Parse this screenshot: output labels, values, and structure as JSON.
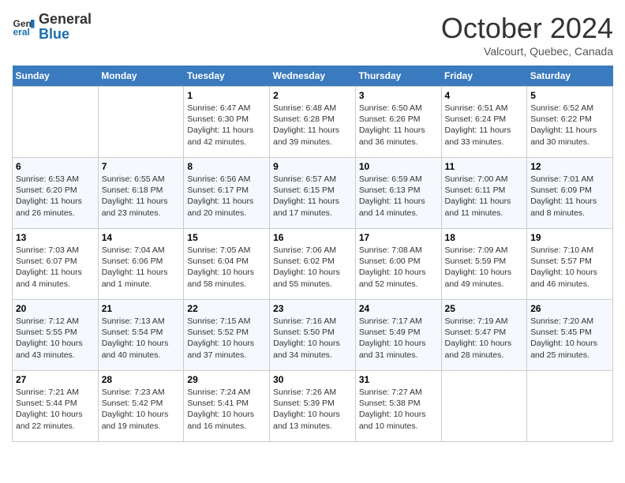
{
  "header": {
    "logo_general": "General",
    "logo_blue": "Blue",
    "month_title": "October 2024",
    "location": "Valcourt, Quebec, Canada"
  },
  "days_of_week": [
    "Sunday",
    "Monday",
    "Tuesday",
    "Wednesday",
    "Thursday",
    "Friday",
    "Saturday"
  ],
  "weeks": [
    [
      {
        "day": "",
        "sunrise": "",
        "sunset": "",
        "daylight": ""
      },
      {
        "day": "",
        "sunrise": "",
        "sunset": "",
        "daylight": ""
      },
      {
        "day": "1",
        "sunrise": "Sunrise: 6:47 AM",
        "sunset": "Sunset: 6:30 PM",
        "daylight": "Daylight: 11 hours and 42 minutes."
      },
      {
        "day": "2",
        "sunrise": "Sunrise: 6:48 AM",
        "sunset": "Sunset: 6:28 PM",
        "daylight": "Daylight: 11 hours and 39 minutes."
      },
      {
        "day": "3",
        "sunrise": "Sunrise: 6:50 AM",
        "sunset": "Sunset: 6:26 PM",
        "daylight": "Daylight: 11 hours and 36 minutes."
      },
      {
        "day": "4",
        "sunrise": "Sunrise: 6:51 AM",
        "sunset": "Sunset: 6:24 PM",
        "daylight": "Daylight: 11 hours and 33 minutes."
      },
      {
        "day": "5",
        "sunrise": "Sunrise: 6:52 AM",
        "sunset": "Sunset: 6:22 PM",
        "daylight": "Daylight: 11 hours and 30 minutes."
      }
    ],
    [
      {
        "day": "6",
        "sunrise": "Sunrise: 6:53 AM",
        "sunset": "Sunset: 6:20 PM",
        "daylight": "Daylight: 11 hours and 26 minutes."
      },
      {
        "day": "7",
        "sunrise": "Sunrise: 6:55 AM",
        "sunset": "Sunset: 6:18 PM",
        "daylight": "Daylight: 11 hours and 23 minutes."
      },
      {
        "day": "8",
        "sunrise": "Sunrise: 6:56 AM",
        "sunset": "Sunset: 6:17 PM",
        "daylight": "Daylight: 11 hours and 20 minutes."
      },
      {
        "day": "9",
        "sunrise": "Sunrise: 6:57 AM",
        "sunset": "Sunset: 6:15 PM",
        "daylight": "Daylight: 11 hours and 17 minutes."
      },
      {
        "day": "10",
        "sunrise": "Sunrise: 6:59 AM",
        "sunset": "Sunset: 6:13 PM",
        "daylight": "Daylight: 11 hours and 14 minutes."
      },
      {
        "day": "11",
        "sunrise": "Sunrise: 7:00 AM",
        "sunset": "Sunset: 6:11 PM",
        "daylight": "Daylight: 11 hours and 11 minutes."
      },
      {
        "day": "12",
        "sunrise": "Sunrise: 7:01 AM",
        "sunset": "Sunset: 6:09 PM",
        "daylight": "Daylight: 11 hours and 8 minutes."
      }
    ],
    [
      {
        "day": "13",
        "sunrise": "Sunrise: 7:03 AM",
        "sunset": "Sunset: 6:07 PM",
        "daylight": "Daylight: 11 hours and 4 minutes."
      },
      {
        "day": "14",
        "sunrise": "Sunrise: 7:04 AM",
        "sunset": "Sunset: 6:06 PM",
        "daylight": "Daylight: 11 hours and 1 minute."
      },
      {
        "day": "15",
        "sunrise": "Sunrise: 7:05 AM",
        "sunset": "Sunset: 6:04 PM",
        "daylight": "Daylight: 10 hours and 58 minutes."
      },
      {
        "day": "16",
        "sunrise": "Sunrise: 7:06 AM",
        "sunset": "Sunset: 6:02 PM",
        "daylight": "Daylight: 10 hours and 55 minutes."
      },
      {
        "day": "17",
        "sunrise": "Sunrise: 7:08 AM",
        "sunset": "Sunset: 6:00 PM",
        "daylight": "Daylight: 10 hours and 52 minutes."
      },
      {
        "day": "18",
        "sunrise": "Sunrise: 7:09 AM",
        "sunset": "Sunset: 5:59 PM",
        "daylight": "Daylight: 10 hours and 49 minutes."
      },
      {
        "day": "19",
        "sunrise": "Sunrise: 7:10 AM",
        "sunset": "Sunset: 5:57 PM",
        "daylight": "Daylight: 10 hours and 46 minutes."
      }
    ],
    [
      {
        "day": "20",
        "sunrise": "Sunrise: 7:12 AM",
        "sunset": "Sunset: 5:55 PM",
        "daylight": "Daylight: 10 hours and 43 minutes."
      },
      {
        "day": "21",
        "sunrise": "Sunrise: 7:13 AM",
        "sunset": "Sunset: 5:54 PM",
        "daylight": "Daylight: 10 hours and 40 minutes."
      },
      {
        "day": "22",
        "sunrise": "Sunrise: 7:15 AM",
        "sunset": "Sunset: 5:52 PM",
        "daylight": "Daylight: 10 hours and 37 minutes."
      },
      {
        "day": "23",
        "sunrise": "Sunrise: 7:16 AM",
        "sunset": "Sunset: 5:50 PM",
        "daylight": "Daylight: 10 hours and 34 minutes."
      },
      {
        "day": "24",
        "sunrise": "Sunrise: 7:17 AM",
        "sunset": "Sunset: 5:49 PM",
        "daylight": "Daylight: 10 hours and 31 minutes."
      },
      {
        "day": "25",
        "sunrise": "Sunrise: 7:19 AM",
        "sunset": "Sunset: 5:47 PM",
        "daylight": "Daylight: 10 hours and 28 minutes."
      },
      {
        "day": "26",
        "sunrise": "Sunrise: 7:20 AM",
        "sunset": "Sunset: 5:45 PM",
        "daylight": "Daylight: 10 hours and 25 minutes."
      }
    ],
    [
      {
        "day": "27",
        "sunrise": "Sunrise: 7:21 AM",
        "sunset": "Sunset: 5:44 PM",
        "daylight": "Daylight: 10 hours and 22 minutes."
      },
      {
        "day": "28",
        "sunrise": "Sunrise: 7:23 AM",
        "sunset": "Sunset: 5:42 PM",
        "daylight": "Daylight: 10 hours and 19 minutes."
      },
      {
        "day": "29",
        "sunrise": "Sunrise: 7:24 AM",
        "sunset": "Sunset: 5:41 PM",
        "daylight": "Daylight: 10 hours and 16 minutes."
      },
      {
        "day": "30",
        "sunrise": "Sunrise: 7:26 AM",
        "sunset": "Sunset: 5:39 PM",
        "daylight": "Daylight: 10 hours and 13 minutes."
      },
      {
        "day": "31",
        "sunrise": "Sunrise: 7:27 AM",
        "sunset": "Sunset: 5:38 PM",
        "daylight": "Daylight: 10 hours and 10 minutes."
      },
      {
        "day": "",
        "sunrise": "",
        "sunset": "",
        "daylight": ""
      },
      {
        "day": "",
        "sunrise": "",
        "sunset": "",
        "daylight": ""
      }
    ]
  ]
}
